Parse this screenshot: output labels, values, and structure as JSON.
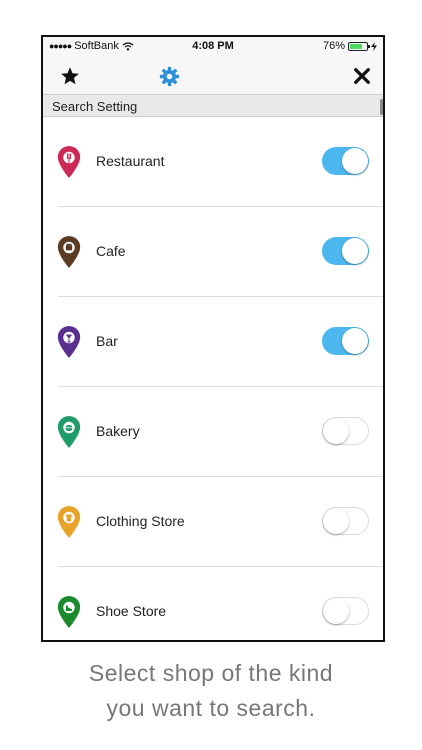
{
  "status_bar": {
    "carrier": "SoftBank",
    "time": "4:08 PM",
    "battery_percent": "76%",
    "battery_level": 0.76
  },
  "navbar": {
    "left_icon": "star-icon",
    "center_icon": "gear-icon",
    "right_icon": "close-icon",
    "accent": "#2f8fd8"
  },
  "section": {
    "title": "Search Setting"
  },
  "categories": [
    {
      "label": "Restaurant",
      "icon": "fork-knife-icon",
      "color": "#cc2a55",
      "enabled": true
    },
    {
      "label": "Cafe",
      "icon": "coffee-cup-icon",
      "color": "#5c3b25",
      "enabled": true
    },
    {
      "label": "Bar",
      "icon": "cocktail-glass-icon",
      "color": "#5a2e8e",
      "enabled": true
    },
    {
      "label": "Bakery",
      "icon": "bread-icon",
      "color": "#1f9c6a",
      "enabled": false
    },
    {
      "label": "Clothing Store",
      "icon": "shirt-icon",
      "color": "#e8a42a",
      "enabled": false
    },
    {
      "label": "Shoe Store",
      "icon": "shoe-icon",
      "color": "#1b8a2d",
      "enabled": false
    }
  ],
  "toggle_on_color": "#4cb7ef",
  "caption": {
    "line1": "Select shop of the kind",
    "line2": "you want to search."
  }
}
